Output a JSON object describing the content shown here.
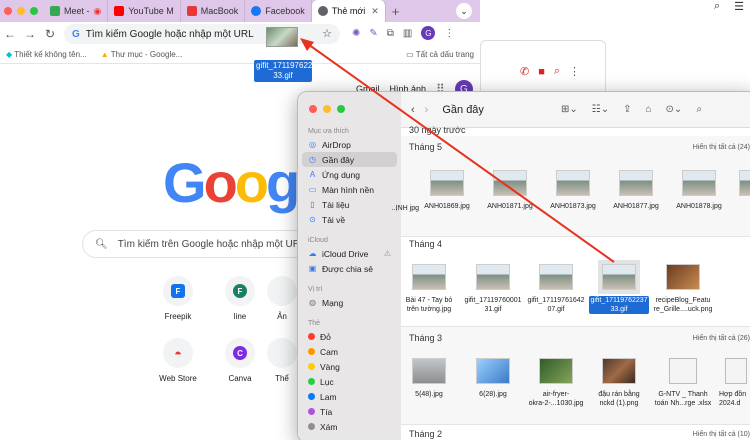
{
  "browser": {
    "tabs": [
      {
        "label": "Meet -",
        "color": "#34a853"
      },
      {
        "label": "YouTube M",
        "color": "#ff0000"
      },
      {
        "label": "MacBook",
        "color": "#e53935"
      },
      {
        "label": "Facebook",
        "color": "#1877f2"
      },
      {
        "label": "Thẻ mới",
        "color": "#5f6368"
      }
    ],
    "omnibox_text": "Tìm kiếm Google hoặc nhập một URL",
    "bookmarks": [
      "Thiết kế không tên...",
      "Thư mục - Google..."
    ],
    "bookmarks_right": "Tất cả dấu trang",
    "profile_letter": "G"
  },
  "google": {
    "links": [
      "Gmail",
      "Hình ảnh"
    ],
    "logo": "Google",
    "search_placeholder": "Tìm kiếm trên Google hoặc nhập một URL",
    "shortcuts": [
      {
        "label": "Freepik",
        "glyph": "F",
        "color": "#1273eb"
      },
      {
        "label": "line",
        "glyph": "F",
        "color": "#1a7f64"
      },
      {
        "label": "Ản",
        "glyph": "",
        "color": "#999999"
      },
      {
        "label": "Web Store",
        "glyph": "",
        "color": "#e53935"
      },
      {
        "label": "Canva",
        "glyph": "C",
        "color": "#7d2ae8"
      },
      {
        "label": "Thể",
        "glyph": "",
        "color": "#999999"
      }
    ]
  },
  "drag": {
    "label_line1": "gifit_17119762237",
    "label_line2": "33.gif"
  },
  "finder": {
    "title": "Gần đây",
    "sidebar": {
      "favorites_header": "Mục ưa thích",
      "favorites": [
        "AirDrop",
        "Gần đây",
        "Ứng dụng",
        "Màn hình nền",
        "Tài liệu",
        "Tải về"
      ],
      "icloud_header": "iCloud",
      "icloud": [
        "iCloud Drive",
        "Được chia sẻ"
      ],
      "locations_header": "Vị trí",
      "locations": [
        "Mạng"
      ],
      "tags_header": "Thẻ",
      "tags": [
        {
          "label": "Đỏ",
          "color": "#ff3b30"
        },
        {
          "label": "Cam",
          "color": "#ff9500"
        },
        {
          "label": "Vàng",
          "color": "#ffcc00"
        },
        {
          "label": "Lục",
          "color": "#28cd41"
        },
        {
          "label": "Lam",
          "color": "#007aff"
        },
        {
          "label": "Tía",
          "color": "#af52de"
        },
        {
          "label": "Xám",
          "color": "#8e8e93"
        }
      ]
    },
    "sections": {
      "s0": {
        "title": "30 ngày trước"
      },
      "s1": {
        "title": "Tháng 5",
        "show_all": "Hiển thị tất cả (24)",
        "files": [
          "ANH01869.jpg",
          "ANH01871.jpg",
          "ANH01873.jpg",
          "ANH01877.jpg",
          "ANH01878.jpg"
        ],
        "partial": "..ỊNH jpg"
      },
      "s2": {
        "title": "Tháng 4",
        "files": [
          {
            "l1": "Bài 47 - Tay bó",
            "l2": "trên tường.jpg"
          },
          {
            "l1": "gifit_17119760001",
            "l2": "31.gif"
          },
          {
            "l1": "gifit_17119761642",
            "l2": "07.gif"
          },
          {
            "l1": "gifit_17119762237",
            "l2": "33.gif"
          },
          {
            "l1": "recipeBlog_Featu",
            "l2": "re_Grille....uck.png"
          }
        ]
      },
      "s3": {
        "title": "Tháng 3",
        "show_all": "Hiển thị tất cả (26)",
        "files": [
          {
            "l1": "5(48).jpg",
            "l2": ""
          },
          {
            "l1": "6(28).jpg",
            "l2": ""
          },
          {
            "l1": "air-fryer-",
            "l2": "okra-2-...1030.jpg"
          },
          {
            "l1": "đậu rán bằng",
            "l2": "nckd (1).png"
          },
          {
            "l1": "G-NTV _ Thanh",
            "l2": "toán Nh...rge .xlsx"
          },
          {
            "l1": "Hợp đồn",
            "l2": "2024.d"
          }
        ]
      },
      "s4": {
        "title": "Tháng 2",
        "show_all": "Hiển thị tất cả (10)"
      }
    }
  }
}
